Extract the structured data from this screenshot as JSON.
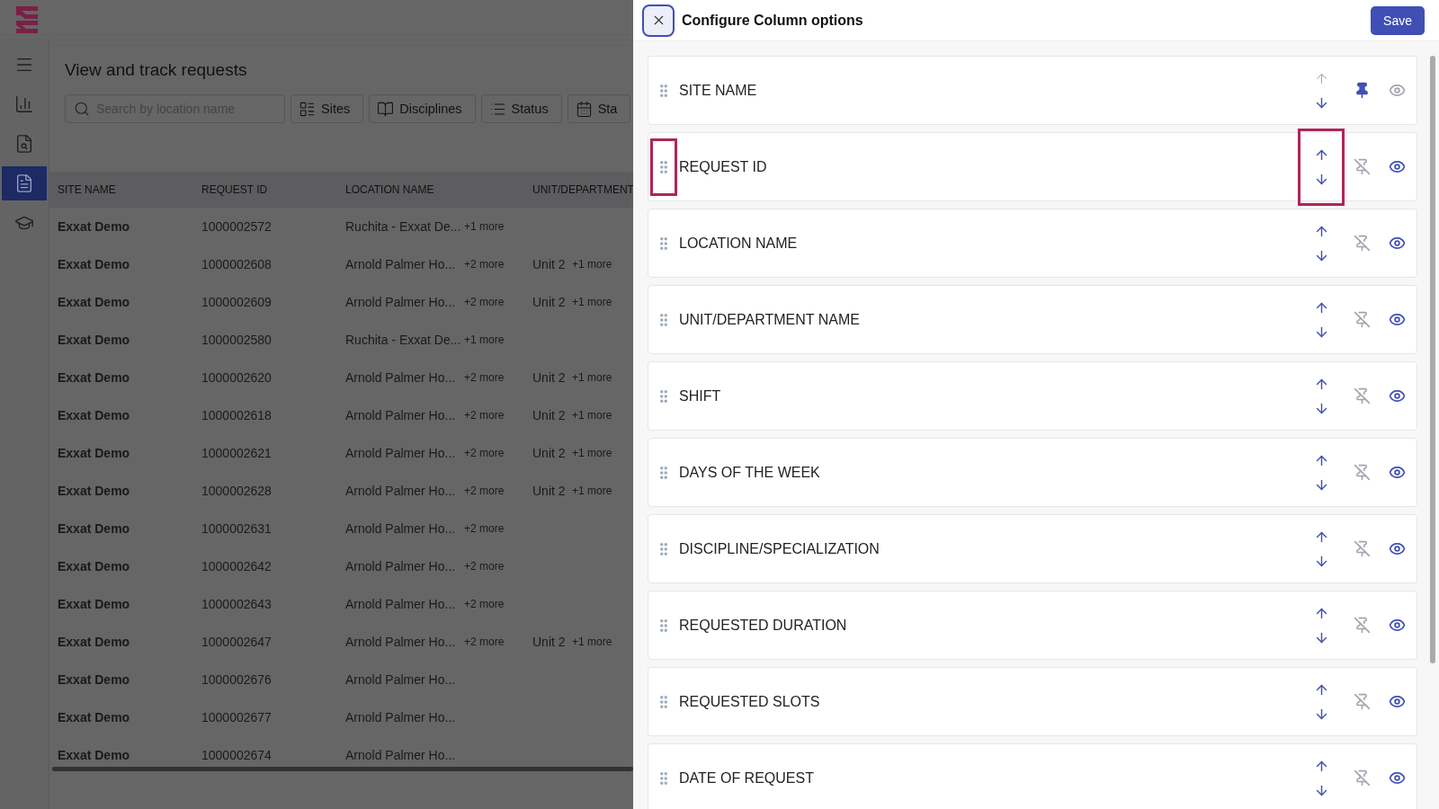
{
  "nav": [
    {
      "selected": false
    },
    {
      "selected": false
    },
    {
      "selected": false
    },
    {
      "selected": true
    },
    {
      "selected": false
    }
  ],
  "page": {
    "title": "View and track requests",
    "search": {
      "placeholder": "Search by location name"
    },
    "filters": [
      "Sites",
      "Disciplines",
      "Status",
      "Sta"
    ]
  },
  "table": {
    "columns": [
      "SITE NAME",
      "REQUEST ID",
      "LOCATION NAME",
      "UNIT/DEPARTMENT"
    ],
    "rows": [
      {
        "site": "Exxat Demo",
        "request_id": "1000002572",
        "location": "Ruchita - Exxat De...",
        "location_more": "+1 more"
      },
      {
        "site": "Exxat Demo",
        "request_id": "1000002608",
        "location": "Arnold Palmer Ho...",
        "location_more": "+2 more",
        "unit": "Unit 2",
        "unit_more": "+1 more"
      },
      {
        "site": "Exxat Demo",
        "request_id": "1000002609",
        "location": "Arnold Palmer Ho...",
        "location_more": "+2 more",
        "unit": "Unit 2",
        "unit_more": "+1 more"
      },
      {
        "site": "Exxat Demo",
        "request_id": "1000002580",
        "location": "Ruchita - Exxat De...",
        "location_more": "+1 more"
      },
      {
        "site": "Exxat Demo",
        "request_id": "1000002620",
        "location": "Arnold Palmer Ho...",
        "location_more": "+2 more",
        "unit": "Unit 2",
        "unit_more": "+1 more"
      },
      {
        "site": "Exxat Demo",
        "request_id": "1000002618",
        "location": "Arnold Palmer Ho...",
        "location_more": "+2 more",
        "unit": "Unit 2",
        "unit_more": "+1 more"
      },
      {
        "site": "Exxat Demo",
        "request_id": "1000002621",
        "location": "Arnold Palmer Ho...",
        "location_more": "+2 more",
        "unit": "Unit 2",
        "unit_more": "+1 more"
      },
      {
        "site": "Exxat Demo",
        "request_id": "1000002628",
        "location": "Arnold Palmer Ho...",
        "location_more": "+2 more",
        "unit": "Unit 2",
        "unit_more": "+1 more"
      },
      {
        "site": "Exxat Demo",
        "request_id": "1000002631",
        "location": "Arnold Palmer Ho...",
        "location_more": "+2 more"
      },
      {
        "site": "Exxat Demo",
        "request_id": "1000002642",
        "location": "Arnold Palmer Ho...",
        "location_more": "+2 more"
      },
      {
        "site": "Exxat Demo",
        "request_id": "1000002643",
        "location": "Arnold Palmer Ho...",
        "location_more": "+2 more"
      },
      {
        "site": "Exxat Demo",
        "request_id": "1000002647",
        "location": "Arnold Palmer Ho...",
        "location_more": "+2 more",
        "unit": "Unit 2",
        "unit_more": "+1 more"
      },
      {
        "site": "Exxat Demo",
        "request_id": "1000002676",
        "location": "Arnold Palmer Ho..."
      },
      {
        "site": "Exxat Demo",
        "request_id": "1000002677",
        "location": "Arnold Palmer Ho..."
      },
      {
        "site": "Exxat Demo",
        "request_id": "1000002674",
        "location": "Arnold Palmer Ho..."
      }
    ]
  },
  "panel": {
    "title": "Configure Column options",
    "save": "Save",
    "columns": [
      {
        "name": "SITE NAME",
        "pinned": true,
        "visible": false,
        "can_move_up": false,
        "highlighted": false
      },
      {
        "name": "REQUEST ID",
        "pinned": false,
        "visible": true,
        "can_move_up": true,
        "highlighted": true
      },
      {
        "name": "LOCATION NAME",
        "pinned": false,
        "visible": true,
        "can_move_up": true,
        "highlighted": false
      },
      {
        "name": "UNIT/DEPARTMENT NAME",
        "pinned": false,
        "visible": true,
        "can_move_up": true,
        "highlighted": false
      },
      {
        "name": "SHIFT",
        "pinned": false,
        "visible": true,
        "can_move_up": true,
        "highlighted": false
      },
      {
        "name": "DAYS OF THE WEEK",
        "pinned": false,
        "visible": true,
        "can_move_up": true,
        "highlighted": false
      },
      {
        "name": "DISCIPLINE/SPECIALIZATION",
        "pinned": false,
        "visible": true,
        "can_move_up": true,
        "highlighted": false
      },
      {
        "name": "REQUESTED DURATION",
        "pinned": false,
        "visible": true,
        "can_move_up": true,
        "highlighted": false
      },
      {
        "name": "REQUESTED SLOTS",
        "pinned": false,
        "visible": true,
        "can_move_up": true,
        "highlighted": false
      },
      {
        "name": "DATE OF REQUEST",
        "pinned": false,
        "visible": true,
        "can_move_up": true,
        "highlighted": false
      }
    ]
  }
}
